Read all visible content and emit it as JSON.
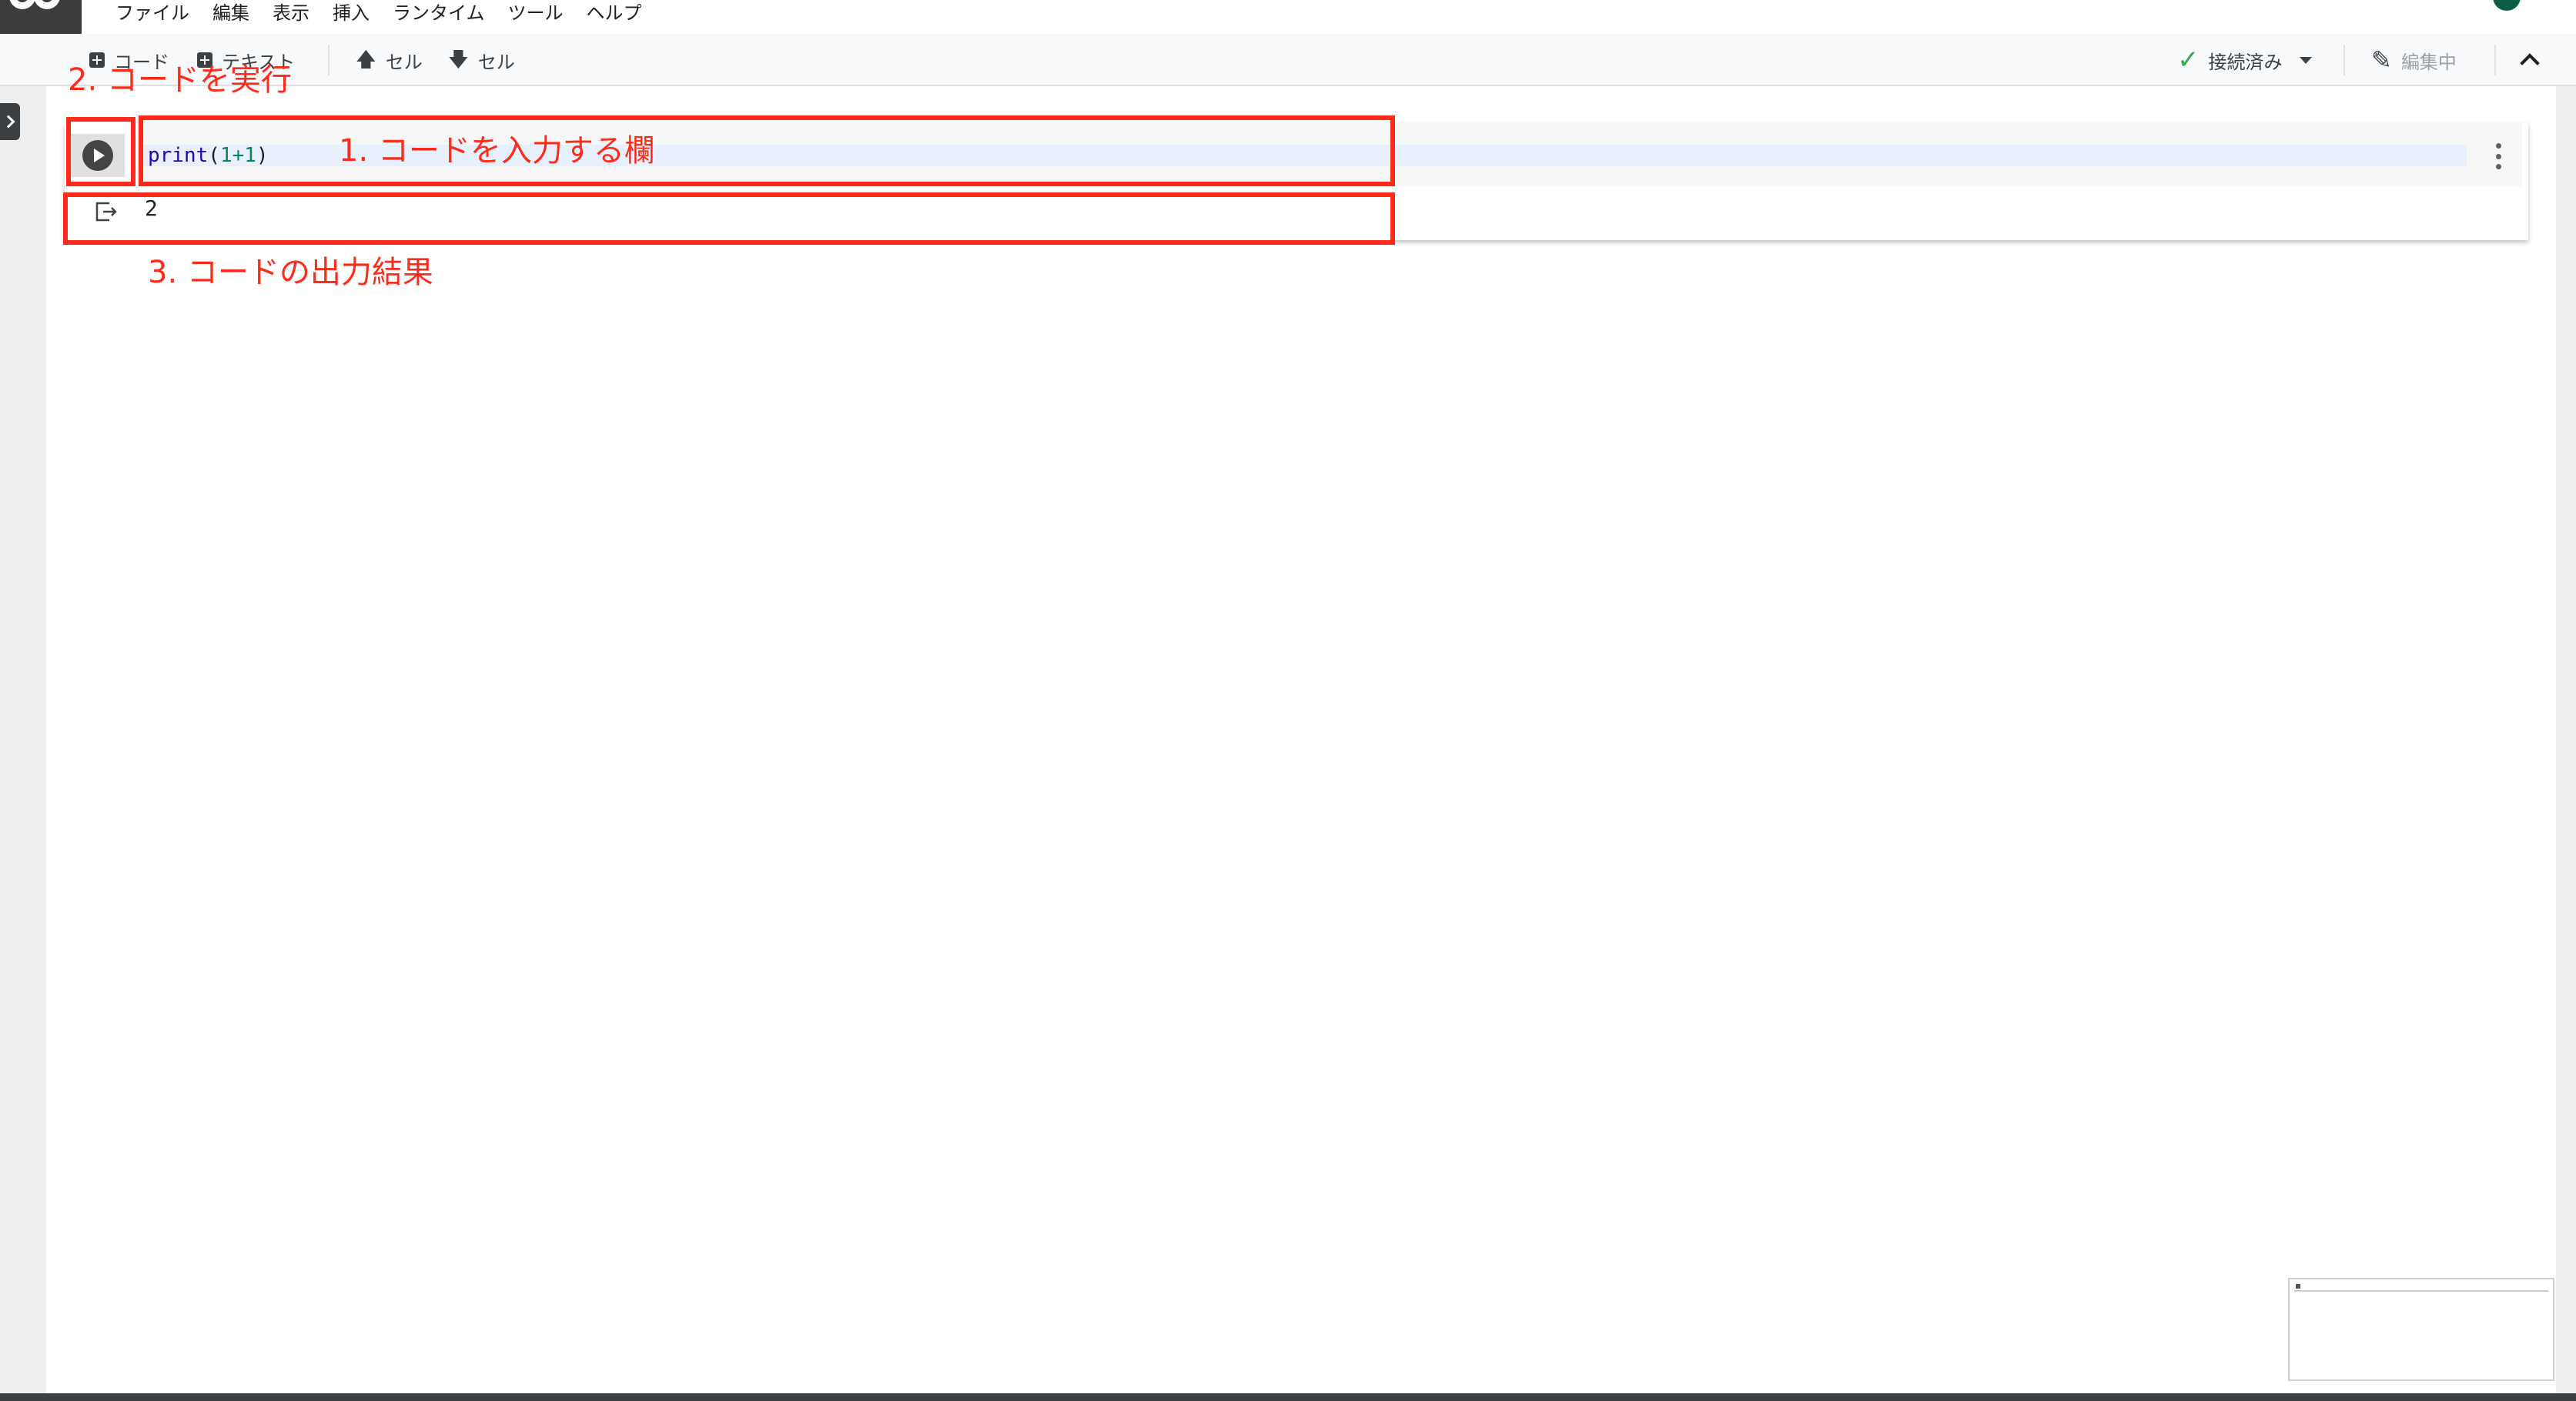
{
  "menu": [
    "ファイル",
    "編集",
    "表示",
    "挿入",
    "ランタイム",
    "ツール",
    "ヘルプ"
  ],
  "toolbar": {
    "add_code": "コード",
    "add_text": "テキスト",
    "cell_up": "セル",
    "cell_down": "セル",
    "connection_status": "接続済み",
    "edit_mode": "編集中"
  },
  "cell": {
    "code": {
      "fn": "print",
      "open": "(",
      "expr": "1+1",
      "close": ")"
    },
    "output": "2"
  },
  "annotations": {
    "input": "1. コードを入力する欄",
    "run": "2. コードを実行",
    "output": "3. コードの出力結果"
  },
  "colors": {
    "annotation": "#ff2b1a",
    "connected": "#34a853",
    "avatar": "#0d5c46"
  }
}
